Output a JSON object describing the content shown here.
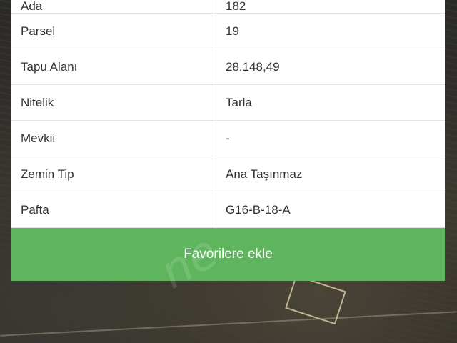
{
  "rows": [
    {
      "label": "Ada",
      "value": "182"
    },
    {
      "label": "Parsel",
      "value": "19"
    },
    {
      "label": "Tapu Alanı",
      "value": "28.148,49"
    },
    {
      "label": "Nitelik",
      "value": "Tarla"
    },
    {
      "label": "Mevkii",
      "value": "-"
    },
    {
      "label": "Zemin Tip",
      "value": "Ana Taşınmaz"
    },
    {
      "label": "Pafta",
      "value": "G16-B-18-A"
    }
  ],
  "button": {
    "favorite_label": "Favorilere ekle",
    "color": "#5fb55e"
  },
  "watermark": {
    "text": "ne"
  }
}
